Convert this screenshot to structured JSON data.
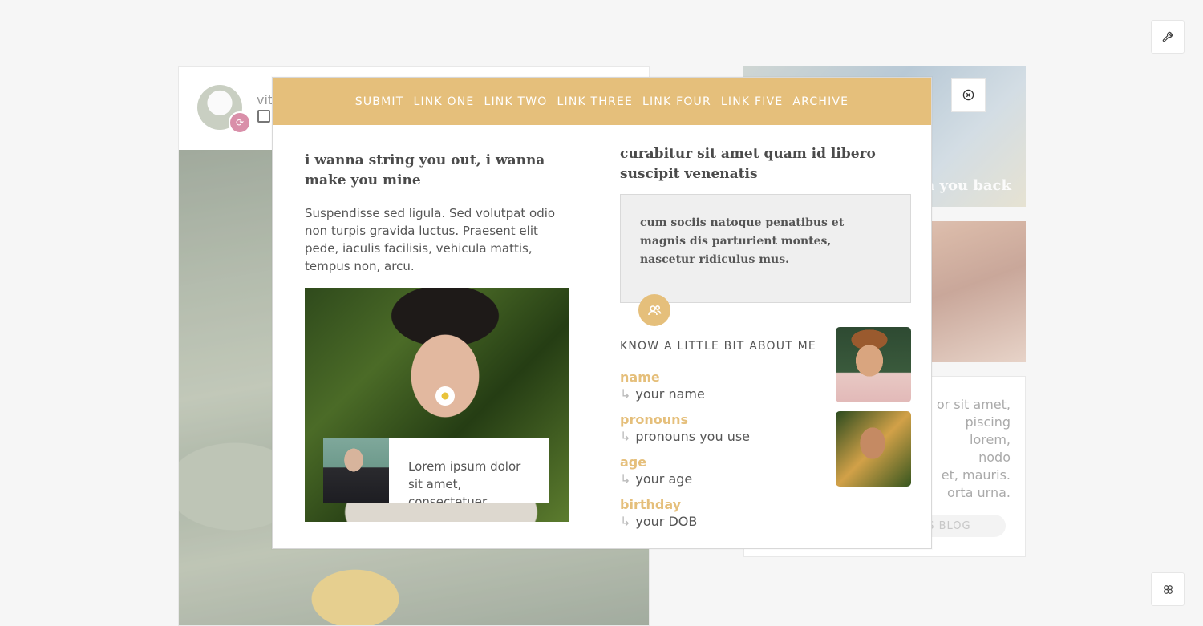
{
  "colors": {
    "accent": "#e5bf7b",
    "badge_pink": "#d98fa9",
    "page_bg": "#f6f6f6"
  },
  "icons": {
    "top_right": "wrench-icon",
    "bottom_right": "clover-icon",
    "close": "close-circle-icon",
    "quote_badge": "users-icon",
    "reblog": "reblog-icon"
  },
  "background": {
    "username": "vit",
    "side_image_text": "h you back",
    "side_text": "or sit amet,\npiscing\nlorem,\nnodo\net, mauris.\norta urna.",
    "side_button": "IS BLOG"
  },
  "modal": {
    "nav": [
      "SUBMIT",
      "LINK ONE",
      "LINK TWO",
      "LINK THREE",
      "LINK FOUR",
      "LINK FIVE",
      "ARCHIVE"
    ],
    "left": {
      "title": "i wanna string you out, i wanna make you mine",
      "body": "Suspendisse sed ligula. Sed volutpat odio non turpis gravida luctus. Praesent elit pede, iaculis facilisis, vehicula mattis, tempus non, arcu.",
      "caption": "Lorem ipsum dolor sit amet, consectetuer"
    },
    "right": {
      "title": "curabitur sit amet quam id libero suscipit venenatis",
      "quote": "cum sociis natoque penatibus et magnis dis parturient montes, nascetur ridiculus mus.",
      "about_heading": "KNOW A LITTLE BIT ABOUT ME",
      "about": [
        {
          "label": "name",
          "value": "your name"
        },
        {
          "label": "pronouns",
          "value": "pronouns you use"
        },
        {
          "label": "age",
          "value": "your age"
        },
        {
          "label": "birthday",
          "value": "your DOB"
        }
      ],
      "arrow": "↳"
    }
  }
}
